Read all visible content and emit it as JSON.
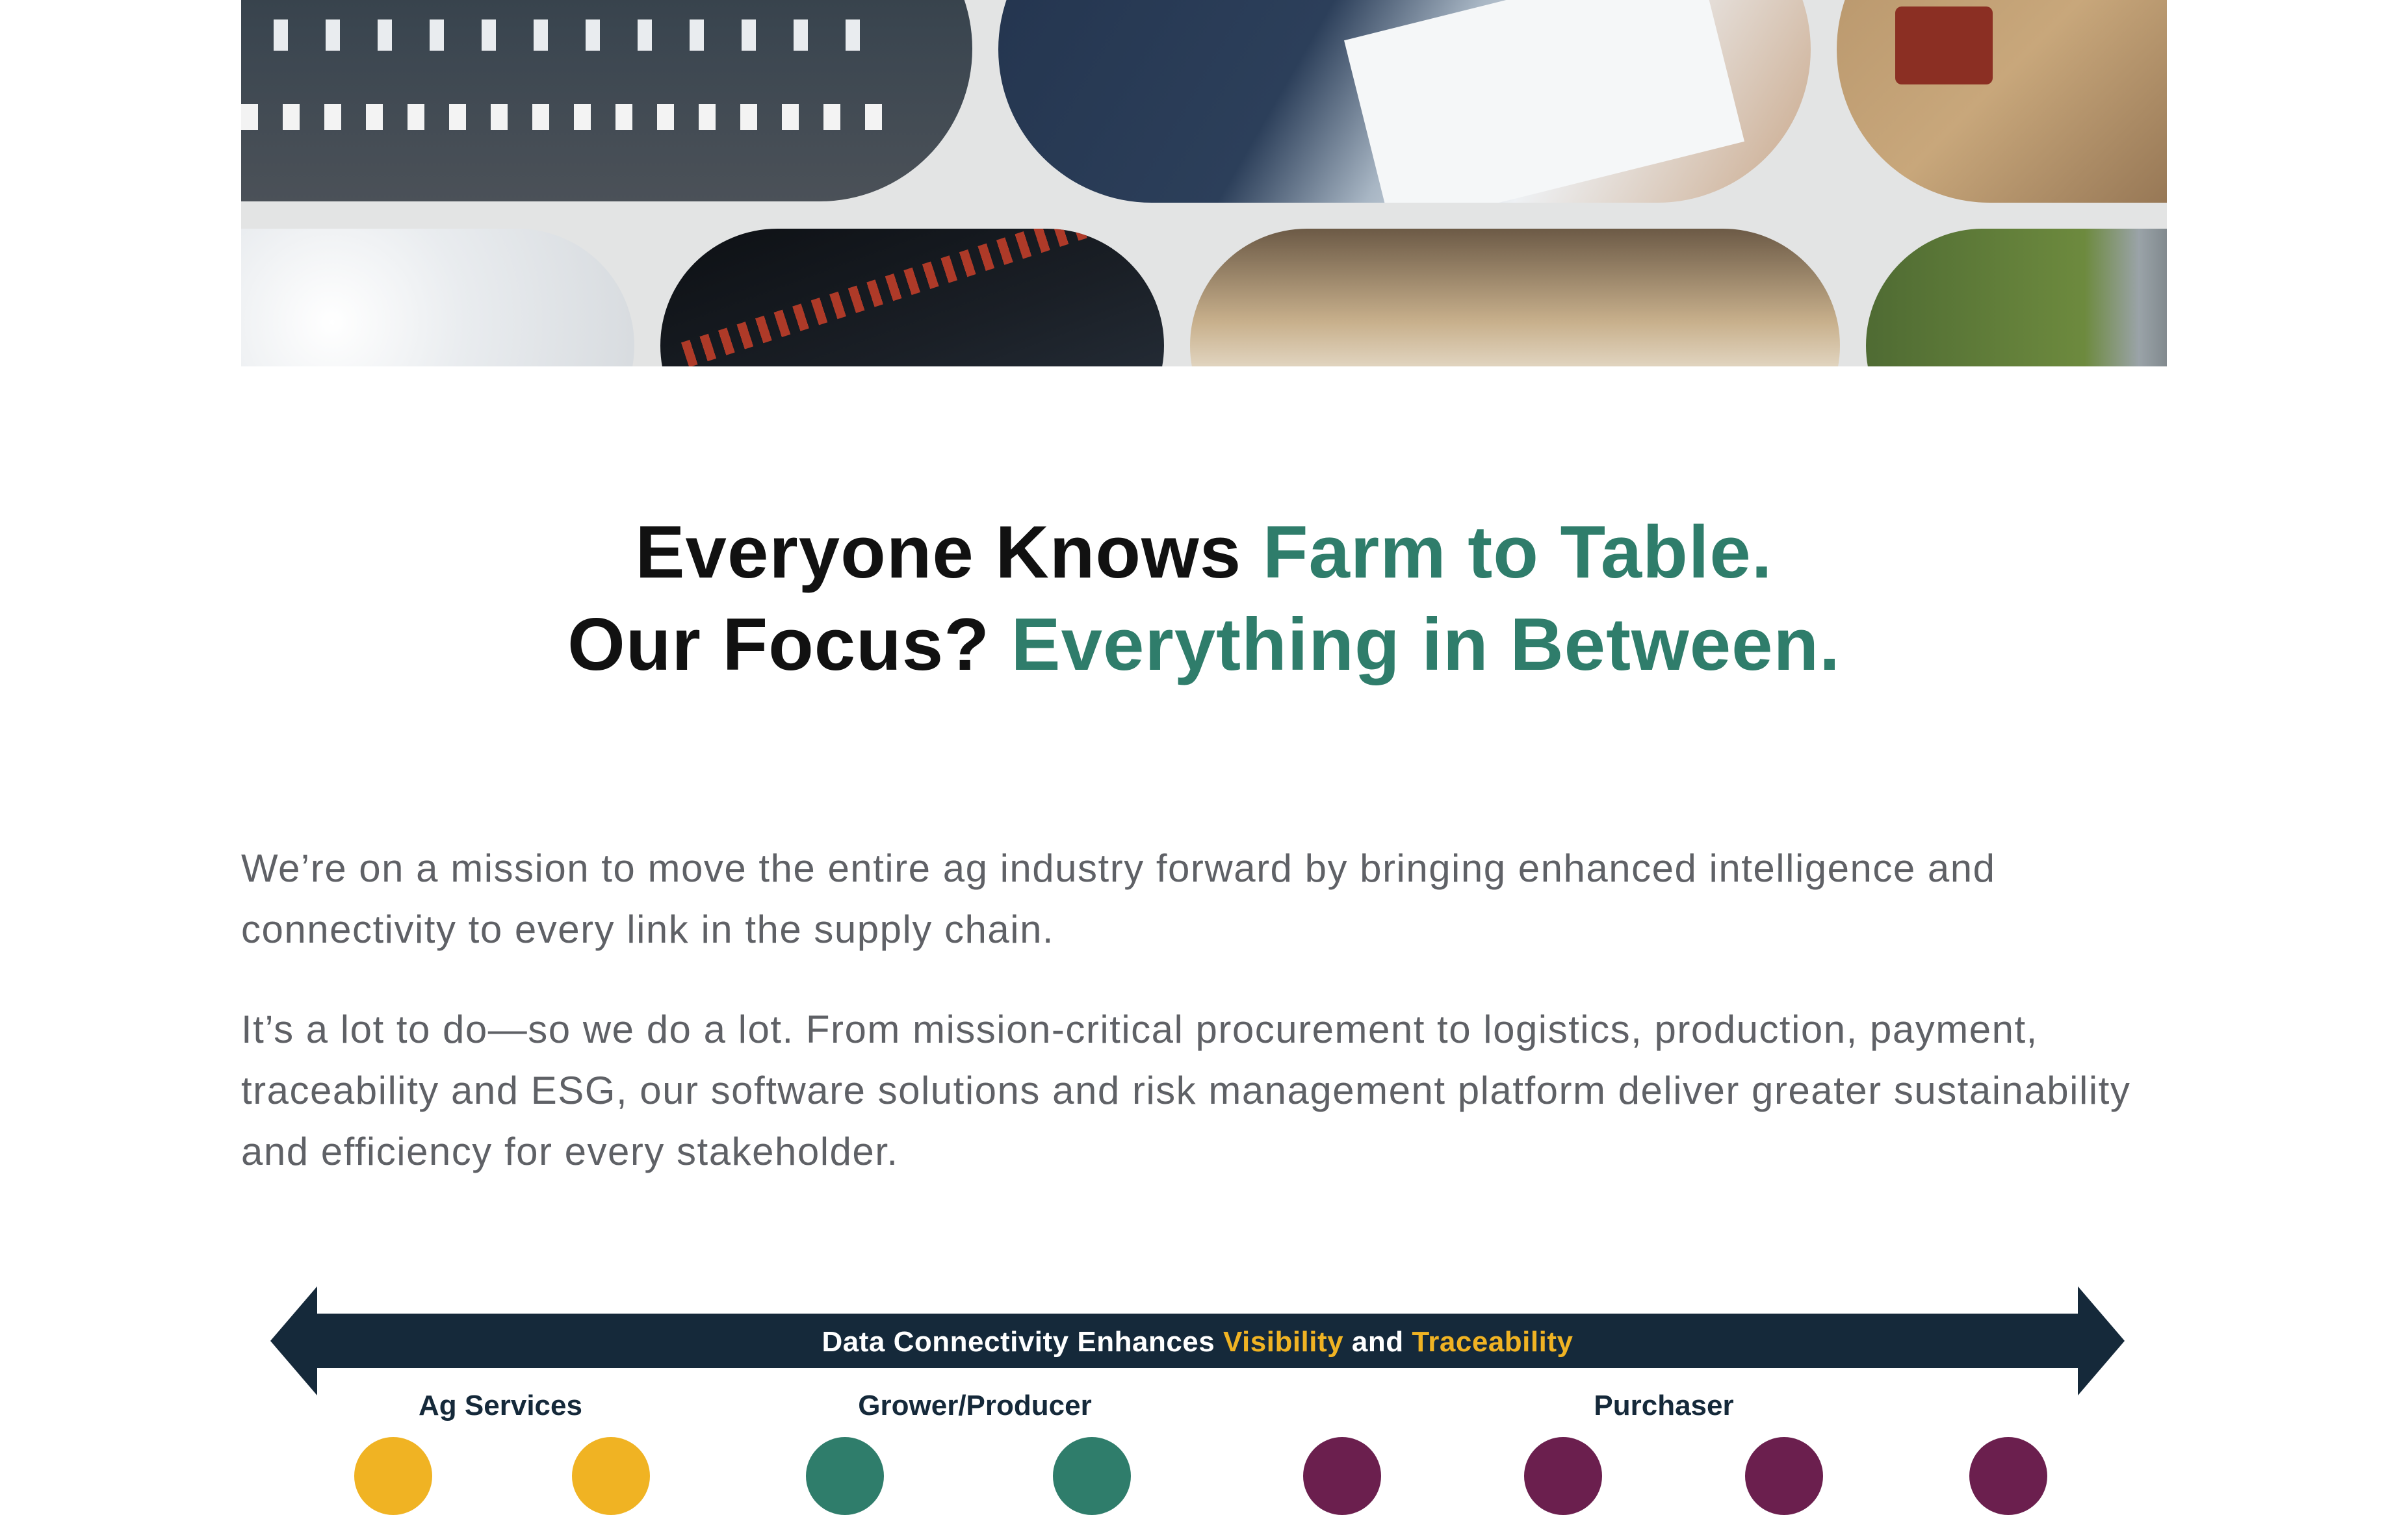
{
  "headline": {
    "line1_dark": "Everyone Knows",
    "line1_accent": "Farm to Table.",
    "line2_dark": "Our Focus?",
    "line2_accent": "Everything in Between."
  },
  "intro": {
    "paragraph1": "We’re on a mission to move the entire ag industry forward by bringing enhanced intelligence and connectivity to every link in the supply chain.",
    "paragraph2": "It’s a lot to do—so we do a lot. From mission-critical procurement to logistics, production, payment, traceability and ESG, our software solutions and risk management platform deliver greater sustainability and efficiency for every stakeholder."
  },
  "banner": {
    "text_before": "Data Connectivity Enhances",
    "highlight1": "Visibility",
    "text_middle": "and",
    "highlight2": "Traceability"
  },
  "stages": {
    "ag_services": "Ag Services",
    "grower_producer": "Grower/Producer",
    "purchaser": "Purchaser"
  },
  "colors": {
    "accent_green": "#2f7d6b",
    "banner_navy": "#15293a",
    "highlight_yellow": "#f0b323",
    "dot_yellow": "#f0b323",
    "dot_teal": "#2f7d6b",
    "dot_purple": "#6b1f4e"
  }
}
